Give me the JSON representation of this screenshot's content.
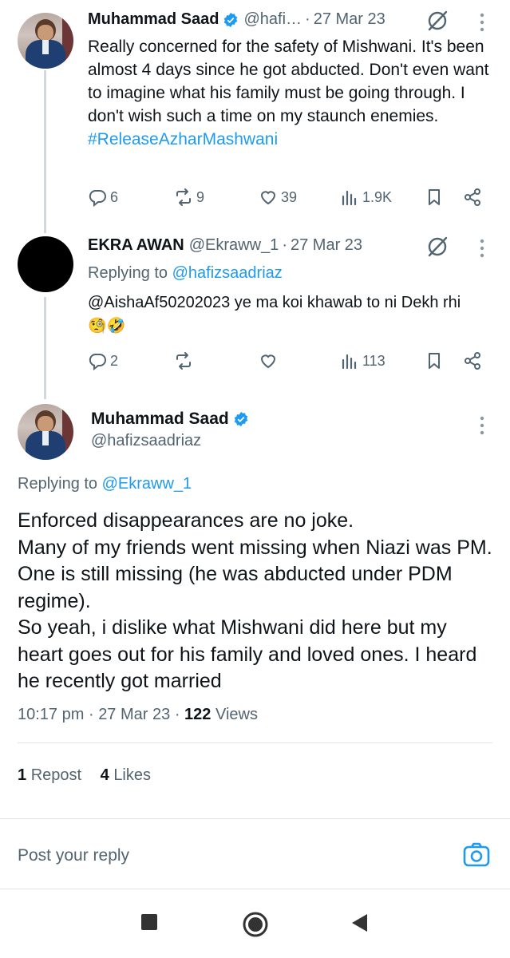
{
  "tweet1": {
    "name": "Muhammad Saad",
    "handle": "@hafi…",
    "separator": "·",
    "time": "27 Mar 23",
    "text": "Really concerned for the safety of Mishwani. It's been almost 4 days since he got abducted. Don't even want to imagine what his family must be going through. I don't wish such a time on my staunch enemies.",
    "hashtag": "#ReleaseAzharMashwani",
    "replies": "6",
    "reposts": "9",
    "likes": "39",
    "views": "1.9K"
  },
  "tweet2": {
    "name": "EKRA AWAN",
    "handle": "@Ekraww_1",
    "separator": "·",
    "time": "27 Mar 23",
    "replying_label": "Replying to",
    "replying_handle": "@hafizsaadriaz",
    "text": "@AishaAf50202023 ye ma koi khawab to ni Dekh rhi",
    "emoji": "🧐🤣",
    "replies": "2",
    "views": "113"
  },
  "main": {
    "name": "Muhammad Saad",
    "handle": "@hafizsaadriaz",
    "replying_label": "Replying to",
    "replying_handle": "@Ekraww_1",
    "text": "Enforced disappearances are no joke.\nMany of my friends went missing when Niazi was PM. One is still missing (he was abducted under PDM regime).\nSo yeah, i dislike what Mishwani did here but my heart goes out for his family and loved ones. I heard he recently got married",
    "time": "10:17 pm",
    "date": "27 Mar 23",
    "separator": "·",
    "views_count": "122",
    "views_label": "Views",
    "reposts_count": "1",
    "reposts_label": "Repost",
    "likes_count": "4",
    "likes_label": "Likes"
  },
  "composer": {
    "placeholder": "Post your reply"
  },
  "icons": {
    "verified": "verified-badge-icon",
    "grok": "grok-icon",
    "more": "more-vertical-icon",
    "reply": "reply-icon",
    "repost": "repost-icon",
    "like": "like-icon",
    "views": "views-icon",
    "bookmark": "bookmark-icon",
    "share": "share-icon",
    "camera": "camera-icon",
    "nav_recent": "recent-apps-icon",
    "nav_home": "home-icon",
    "nav_back": "back-icon"
  },
  "colors": {
    "accent": "#1d9bf0",
    "text": "#0f1419",
    "secondary": "#536471"
  }
}
